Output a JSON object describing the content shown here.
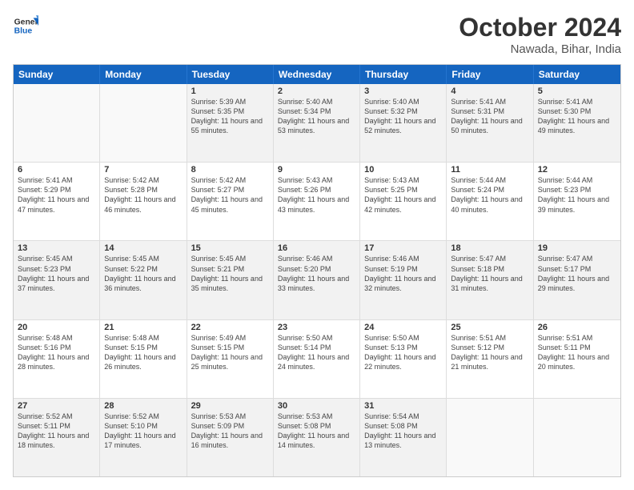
{
  "logo": {
    "line1": "General",
    "line2": "Blue"
  },
  "title": "October 2024",
  "subtitle": "Nawada, Bihar, India",
  "header_days": [
    "Sunday",
    "Monday",
    "Tuesday",
    "Wednesday",
    "Thursday",
    "Friday",
    "Saturday"
  ],
  "rows": [
    [
      {
        "day": "",
        "text": ""
      },
      {
        "day": "",
        "text": ""
      },
      {
        "day": "1",
        "text": "Sunrise: 5:39 AM\nSunset: 5:35 PM\nDaylight: 11 hours and 55 minutes."
      },
      {
        "day": "2",
        "text": "Sunrise: 5:40 AM\nSunset: 5:34 PM\nDaylight: 11 hours and 53 minutes."
      },
      {
        "day": "3",
        "text": "Sunrise: 5:40 AM\nSunset: 5:32 PM\nDaylight: 11 hours and 52 minutes."
      },
      {
        "day": "4",
        "text": "Sunrise: 5:41 AM\nSunset: 5:31 PM\nDaylight: 11 hours and 50 minutes."
      },
      {
        "day": "5",
        "text": "Sunrise: 5:41 AM\nSunset: 5:30 PM\nDaylight: 11 hours and 49 minutes."
      }
    ],
    [
      {
        "day": "6",
        "text": "Sunrise: 5:41 AM\nSunset: 5:29 PM\nDaylight: 11 hours and 47 minutes."
      },
      {
        "day": "7",
        "text": "Sunrise: 5:42 AM\nSunset: 5:28 PM\nDaylight: 11 hours and 46 minutes."
      },
      {
        "day": "8",
        "text": "Sunrise: 5:42 AM\nSunset: 5:27 PM\nDaylight: 11 hours and 45 minutes."
      },
      {
        "day": "9",
        "text": "Sunrise: 5:43 AM\nSunset: 5:26 PM\nDaylight: 11 hours and 43 minutes."
      },
      {
        "day": "10",
        "text": "Sunrise: 5:43 AM\nSunset: 5:25 PM\nDaylight: 11 hours and 42 minutes."
      },
      {
        "day": "11",
        "text": "Sunrise: 5:44 AM\nSunset: 5:24 PM\nDaylight: 11 hours and 40 minutes."
      },
      {
        "day": "12",
        "text": "Sunrise: 5:44 AM\nSunset: 5:23 PM\nDaylight: 11 hours and 39 minutes."
      }
    ],
    [
      {
        "day": "13",
        "text": "Sunrise: 5:45 AM\nSunset: 5:23 PM\nDaylight: 11 hours and 37 minutes."
      },
      {
        "day": "14",
        "text": "Sunrise: 5:45 AM\nSunset: 5:22 PM\nDaylight: 11 hours and 36 minutes."
      },
      {
        "day": "15",
        "text": "Sunrise: 5:45 AM\nSunset: 5:21 PM\nDaylight: 11 hours and 35 minutes."
      },
      {
        "day": "16",
        "text": "Sunrise: 5:46 AM\nSunset: 5:20 PM\nDaylight: 11 hours and 33 minutes."
      },
      {
        "day": "17",
        "text": "Sunrise: 5:46 AM\nSunset: 5:19 PM\nDaylight: 11 hours and 32 minutes."
      },
      {
        "day": "18",
        "text": "Sunrise: 5:47 AM\nSunset: 5:18 PM\nDaylight: 11 hours and 31 minutes."
      },
      {
        "day": "19",
        "text": "Sunrise: 5:47 AM\nSunset: 5:17 PM\nDaylight: 11 hours and 29 minutes."
      }
    ],
    [
      {
        "day": "20",
        "text": "Sunrise: 5:48 AM\nSunset: 5:16 PM\nDaylight: 11 hours and 28 minutes."
      },
      {
        "day": "21",
        "text": "Sunrise: 5:48 AM\nSunset: 5:15 PM\nDaylight: 11 hours and 26 minutes."
      },
      {
        "day": "22",
        "text": "Sunrise: 5:49 AM\nSunset: 5:15 PM\nDaylight: 11 hours and 25 minutes."
      },
      {
        "day": "23",
        "text": "Sunrise: 5:50 AM\nSunset: 5:14 PM\nDaylight: 11 hours and 24 minutes."
      },
      {
        "day": "24",
        "text": "Sunrise: 5:50 AM\nSunset: 5:13 PM\nDaylight: 11 hours and 22 minutes."
      },
      {
        "day": "25",
        "text": "Sunrise: 5:51 AM\nSunset: 5:12 PM\nDaylight: 11 hours and 21 minutes."
      },
      {
        "day": "26",
        "text": "Sunrise: 5:51 AM\nSunset: 5:11 PM\nDaylight: 11 hours and 20 minutes."
      }
    ],
    [
      {
        "day": "27",
        "text": "Sunrise: 5:52 AM\nSunset: 5:11 PM\nDaylight: 11 hours and 18 minutes."
      },
      {
        "day": "28",
        "text": "Sunrise: 5:52 AM\nSunset: 5:10 PM\nDaylight: 11 hours and 17 minutes."
      },
      {
        "day": "29",
        "text": "Sunrise: 5:53 AM\nSunset: 5:09 PM\nDaylight: 11 hours and 16 minutes."
      },
      {
        "day": "30",
        "text": "Sunrise: 5:53 AM\nSunset: 5:08 PM\nDaylight: 11 hours and 14 minutes."
      },
      {
        "day": "31",
        "text": "Sunrise: 5:54 AM\nSunset: 5:08 PM\nDaylight: 11 hours and 13 minutes."
      },
      {
        "day": "",
        "text": ""
      },
      {
        "day": "",
        "text": ""
      }
    ]
  ]
}
